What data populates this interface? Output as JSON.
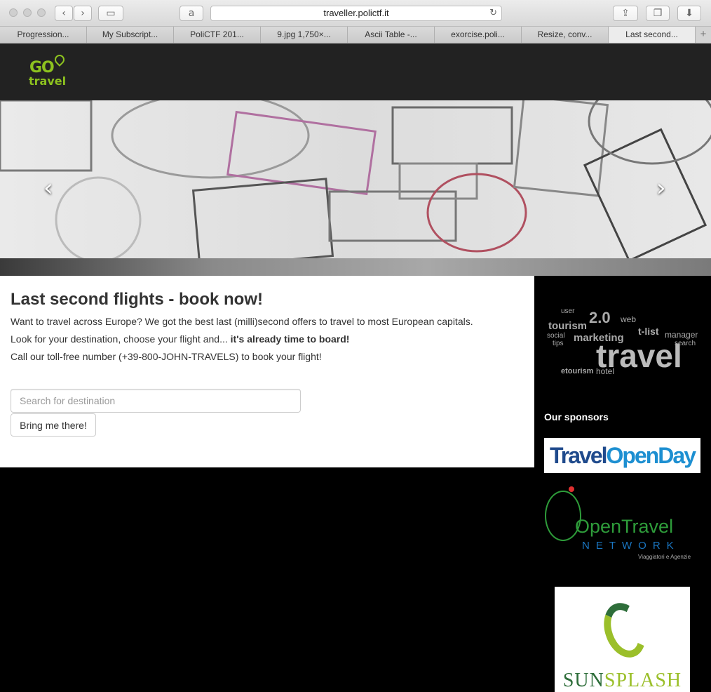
{
  "browser": {
    "url": "traveller.polictf.it",
    "icons": {
      "back": "chevron-left-icon",
      "forward": "chevron-right-icon",
      "sidebar": "sidebar-icon",
      "amazon": "amazon-icon",
      "reload": "reload-icon",
      "share": "share-icon",
      "tabs": "tabs-icon",
      "downloads": "downloads-icon"
    },
    "tabs": [
      {
        "label": "Progression..."
      },
      {
        "label": "My Subscript..."
      },
      {
        "label": "PoliCTF 201..."
      },
      {
        "label": "9.jpg 1,750×..."
      },
      {
        "label": "Ascii Table -..."
      },
      {
        "label": "exorcise.poli..."
      },
      {
        "label": "Resize, conv..."
      },
      {
        "label": "Last second..."
      }
    ],
    "new_tab_label": "+"
  },
  "site": {
    "logo_go": "GO",
    "logo_travel": "travel"
  },
  "carousel": {
    "prev_label": "‹",
    "next_label": "›"
  },
  "main": {
    "title": "Last second flights - book now!",
    "line1": "Want to travel across Europe? We got the best last (milli)second offers to travel to most European capitals.",
    "line2_prefix": "Look for your destination, choose your flight and... ",
    "line2_bold": "it's already time to board!",
    "line3": "Call our toll-free number (+39-800-JOHN-TRAVELS) to book your flight!",
    "search_placeholder": "Search for destination",
    "search_value": "",
    "button_label": "Bring me there!"
  },
  "sidebar": {
    "wordcloud_words": [
      "tourism",
      "2.0",
      "web",
      "marketing",
      "travel",
      "etourism",
      "hotel",
      "manager",
      "user",
      "social",
      "tips",
      "search",
      "t-list"
    ],
    "sponsors_title": "Our sponsors",
    "sponsor1_part1": "Travel",
    "sponsor1_part2": "OpenDay",
    "sponsor2_name": "OpenTravel",
    "sponsor2_network": "NETWORK",
    "sponsor2_sub": "Viaggiatori e Agenzie",
    "sponsor3_part1": "SUN",
    "sponsor3_part2": "SPLASH"
  }
}
